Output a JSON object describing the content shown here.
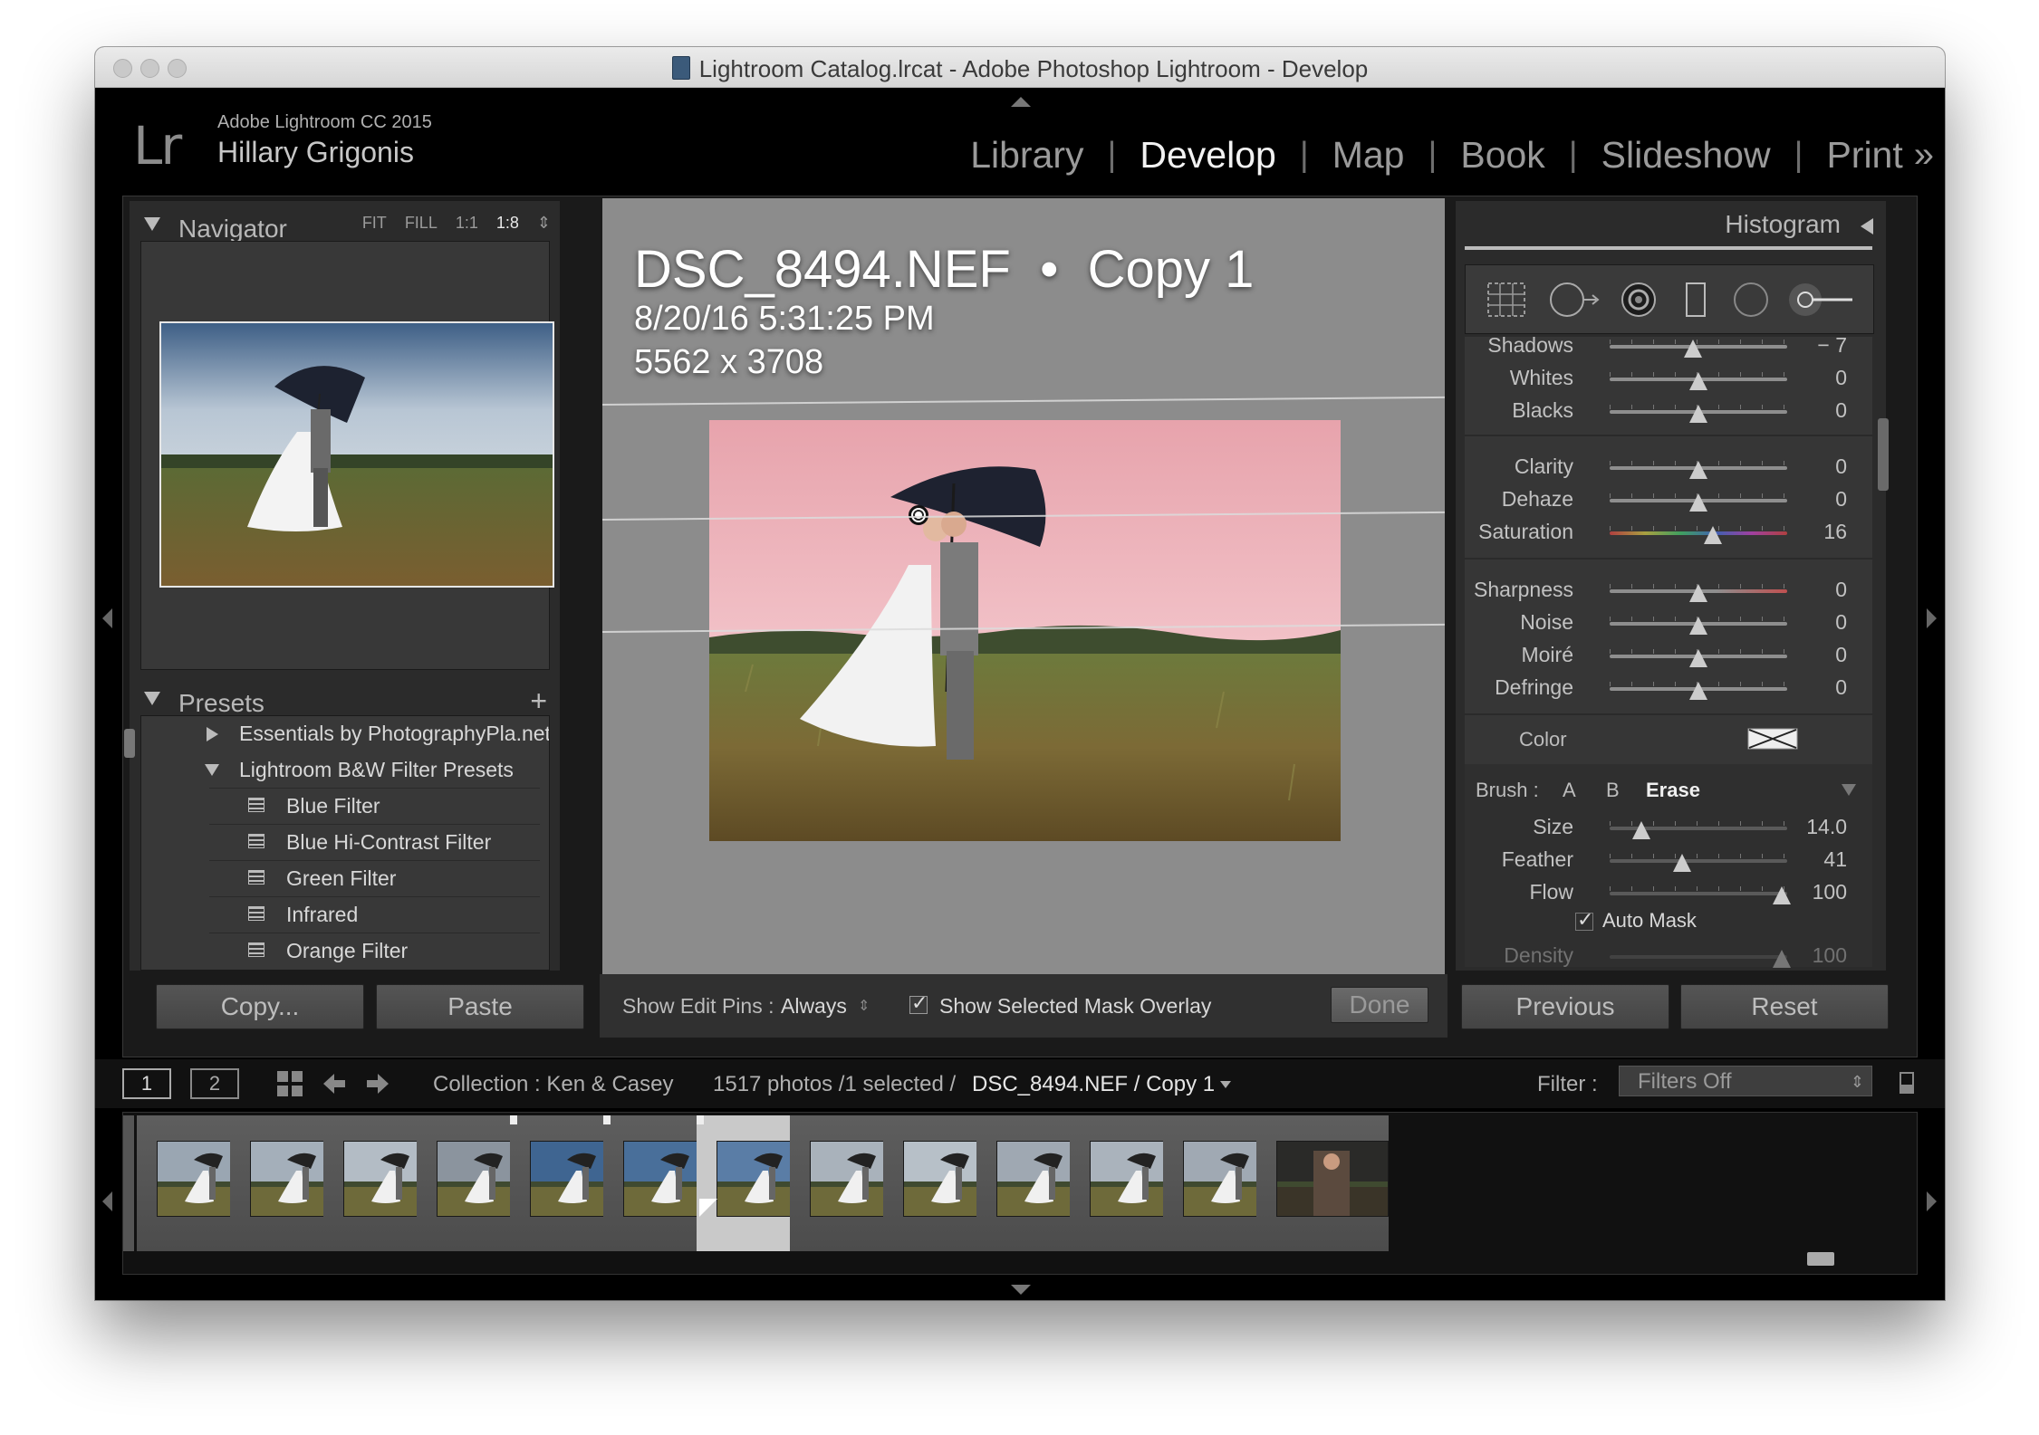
{
  "window": {
    "title": "Lightroom Catalog.lrcat - Adobe Photoshop Lightroom - Develop"
  },
  "identity": {
    "logo": "Lr",
    "product": "Adobe Lightroom CC 2015",
    "user": "Hillary Grigonis"
  },
  "modules": [
    {
      "label": "Library",
      "active": false
    },
    {
      "label": "Develop",
      "active": true
    },
    {
      "label": "Map",
      "active": false
    },
    {
      "label": "Book",
      "active": false
    },
    {
      "label": "Slideshow",
      "active": false
    },
    {
      "label": "Print",
      "active": false
    }
  ],
  "module_more": "»",
  "navigator": {
    "title": "Navigator",
    "options": [
      "FIT",
      "FILL",
      "1:1",
      "1:8"
    ],
    "selected": "1:8"
  },
  "presets": {
    "title": "Presets",
    "add": "+",
    "folders": [
      {
        "label": "Essentials by PhotographyPla.net",
        "expanded": false
      },
      {
        "label": "Lightroom B&W Filter Presets",
        "expanded": true
      }
    ],
    "items": [
      "Blue Filter",
      "Blue Hi-Contrast Filter",
      "Green Filter",
      "Infrared",
      "Orange Filter"
    ]
  },
  "left_buttons": {
    "copy": "Copy...",
    "paste": "Paste"
  },
  "photo": {
    "filename": "DSC_8494.NEF",
    "separator": "•",
    "copy": "Copy 1",
    "datetime": "8/20/16 5:31:25 PM",
    "dimensions": "5562 x 3708"
  },
  "toolbar": {
    "show_pins_label": "Show Edit Pins :",
    "show_pins_value": "Always",
    "overlay_label": "Show Selected Mask Overlay",
    "overlay_checked": true,
    "done": "Done"
  },
  "right": {
    "histogram": "Histogram",
    "tools": [
      "crop-overlay-icon",
      "spot-removal-icon",
      "red-eye-icon",
      "graduated-filter-icon",
      "radial-filter-icon",
      "adjustment-brush-icon"
    ],
    "groups": [
      [
        {
          "label": "Shadows",
          "value": "− 7",
          "pos": 0.47
        },
        {
          "label": "Whites",
          "value": "0",
          "pos": 0.5
        },
        {
          "label": "Blacks",
          "value": "0",
          "pos": 0.5
        }
      ],
      [
        {
          "label": "Clarity",
          "value": "0",
          "pos": 0.5
        },
        {
          "label": "Dehaze",
          "value": "0",
          "pos": 0.5
        },
        {
          "label": "Saturation",
          "value": "16",
          "pos": 0.58,
          "track": "sat"
        }
      ],
      [
        {
          "label": "Sharpness",
          "value": "0",
          "pos": 0.5,
          "track": "red"
        },
        {
          "label": "Noise",
          "value": "0",
          "pos": 0.5
        },
        {
          "label": "Moiré",
          "value": "0",
          "pos": 0.5
        },
        {
          "label": "Defringe",
          "value": "0",
          "pos": 0.5
        }
      ]
    ],
    "color_label": "Color",
    "brush": {
      "label": "Brush :",
      "a": "A",
      "b": "B",
      "erase": "Erase",
      "size_label": "Size",
      "size_value": "14.0",
      "size_pos": 0.18,
      "feather_label": "Feather",
      "feather_value": "41",
      "feather_pos": 0.41,
      "flow_label": "Flow",
      "flow_value": "100",
      "flow_pos": 0.97,
      "automask_label": "Auto Mask",
      "automask_checked": true,
      "density_label": "Density",
      "density_value": "100",
      "density_pos": 0.97
    },
    "previous": "Previous",
    "reset": "Reset"
  },
  "filmstrip_bar": {
    "screen1": "1",
    "screen2": "2",
    "collection": "Collection : Ken & Casey",
    "count": "1517 photos /1 selected /",
    "current": "DSC_8494.NEF / Copy 1",
    "filter_label": "Filter :",
    "filter_value": "Filters Off"
  },
  "filmstrip": {
    "count": 13,
    "selected_index": 6,
    "badges": [
      4,
      6
    ],
    "flags": [
      4,
      5,
      6
    ]
  }
}
